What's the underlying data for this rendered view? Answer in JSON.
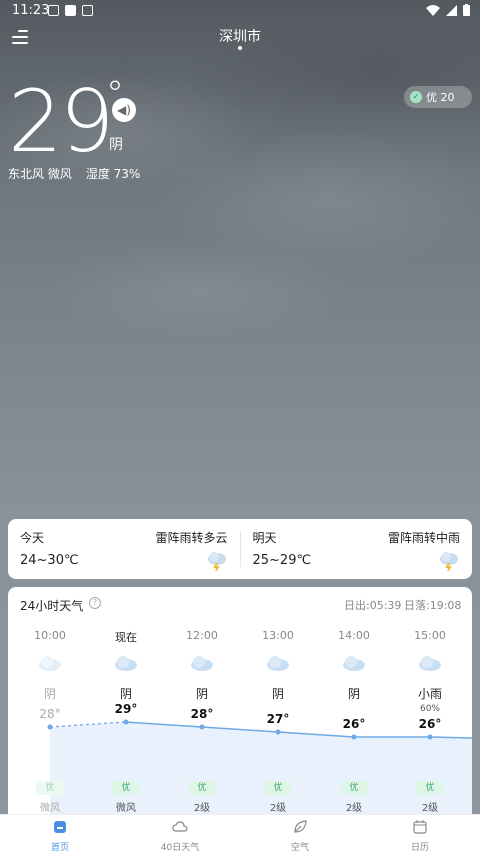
{
  "status": {
    "time": "11:23"
  },
  "header": {
    "city": "深圳市"
  },
  "current": {
    "temperature": "29",
    "degree": "°",
    "condition": "阴",
    "wind": "东北风 微风",
    "humidity": "湿度 73%",
    "aqi": "优 20"
  },
  "daily": [
    {
      "label": "今天",
      "condition": "雷阵雨转多云",
      "range": "24~30℃"
    },
    {
      "label": "明天",
      "condition": "雷阵雨转中雨",
      "range": "25~29℃"
    }
  ],
  "hourly": {
    "title": "24小时天气",
    "sunrise": "日出:05:39",
    "sunset": "日落:19:08",
    "hours": [
      {
        "time": "10:00",
        "condition": "阴",
        "prob": "",
        "temp": "28°",
        "temp_value": 28,
        "aqi": "优",
        "wind": "微风",
        "past": true
      },
      {
        "time": "现在",
        "condition": "阴",
        "prob": "",
        "temp": "29°",
        "temp_value": 29,
        "aqi": "优",
        "wind": "微风",
        "now": true
      },
      {
        "time": "12:00",
        "condition": "阴",
        "prob": "",
        "temp": "28°",
        "temp_value": 28,
        "aqi": "优",
        "wind": "2级"
      },
      {
        "time": "13:00",
        "condition": "阴",
        "prob": "",
        "temp": "27°",
        "temp_value": 27,
        "aqi": "优",
        "wind": "2级"
      },
      {
        "time": "14:00",
        "condition": "阴",
        "prob": "",
        "temp": "26°",
        "temp_value": 26,
        "aqi": "优",
        "wind": "2级"
      },
      {
        "time": "15:00",
        "condition": "小雨",
        "prob": "60%",
        "temp": "26°",
        "temp_value": 26,
        "aqi": "优",
        "wind": "2级"
      }
    ]
  },
  "nav": [
    {
      "label": "首页",
      "icon": "home-icon",
      "active": true
    },
    {
      "label": "40日天气",
      "icon": "cloud-icon"
    },
    {
      "label": "空气",
      "icon": "leaf-icon"
    },
    {
      "label": "日历",
      "icon": "calendar-icon"
    }
  ],
  "colors": {
    "accent": "#4a90e2",
    "aqi_good": "#39a86a"
  }
}
